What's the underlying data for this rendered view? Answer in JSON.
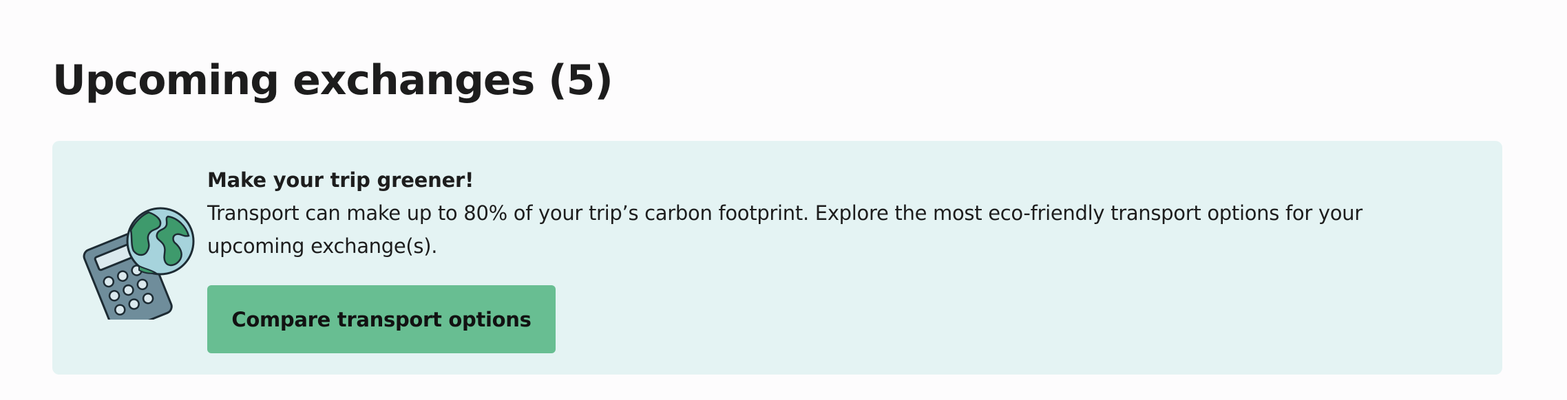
{
  "page": {
    "title": "Upcoming exchanges (5)"
  },
  "banner": {
    "heading": "Make your trip greener!",
    "text": "Transport can make up to 80% of your trip’s carbon footprint. Explore the most eco-friendly transport options for your upcoming exchange(s).",
    "button_label": "Compare transport options",
    "illustration_icon": "calculator-globe-icon"
  },
  "colors": {
    "banner_background": "#e4f3f3",
    "button_background": "#68be92",
    "text": "#1d1d1d"
  }
}
